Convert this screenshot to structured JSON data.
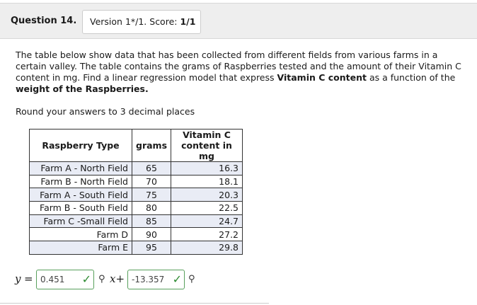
{
  "question": {
    "number_label": "Question 14.",
    "version_text": "Version 1*/1. Score: ",
    "score": "1/1"
  },
  "prompt": {
    "part1": "The table below show data that has been collected from different fields from various farms in a certain valley. The table contains the grams of Raspberries tested and the amount of their Vitamin C content in mg. Find a linear regression model that express ",
    "bold1": "Vitamin C content",
    "part2": " as a function of the ",
    "bold2": "weight of the Raspberries.",
    "round": "Round your answers to 3 decimal places"
  },
  "table": {
    "headers": [
      "Raspberry Type",
      "grams",
      "Vitamin C content in mg"
    ],
    "header_vitc_line1": "Vitamin C",
    "header_vitc_line2": "content in mg",
    "rows": [
      {
        "type": "Farm A - North Field",
        "grams": "65",
        "vitc": "16.3"
      },
      {
        "type": "Farm B - North Field",
        "grams": "70",
        "vitc": "18.1"
      },
      {
        "type": "Farm A - South Field",
        "grams": "75",
        "vitc": "20.3"
      },
      {
        "type": "Farm B - South Field",
        "grams": "80",
        "vitc": "22.5"
      },
      {
        "type": "Farm C -Small Field",
        "grams": "85",
        "vitc": "24.7"
      },
      {
        "type": "Farm D",
        "grams": "90",
        "vitc": "27.2"
      },
      {
        "type": "Farm E",
        "grams": "95",
        "vitc": "29.8"
      }
    ]
  },
  "answer": {
    "y_label": "y",
    "equals": "=",
    "slope_value": "0.451",
    "x_label": "x",
    "plus": "+",
    "intercept_value": "-13.357",
    "check_icon": "check-icon",
    "key_icon": "key-icon"
  },
  "colors": {
    "correct": "#2e8b32",
    "alt_row": "#e9ecf5",
    "header_bg": "#eeeeee"
  }
}
